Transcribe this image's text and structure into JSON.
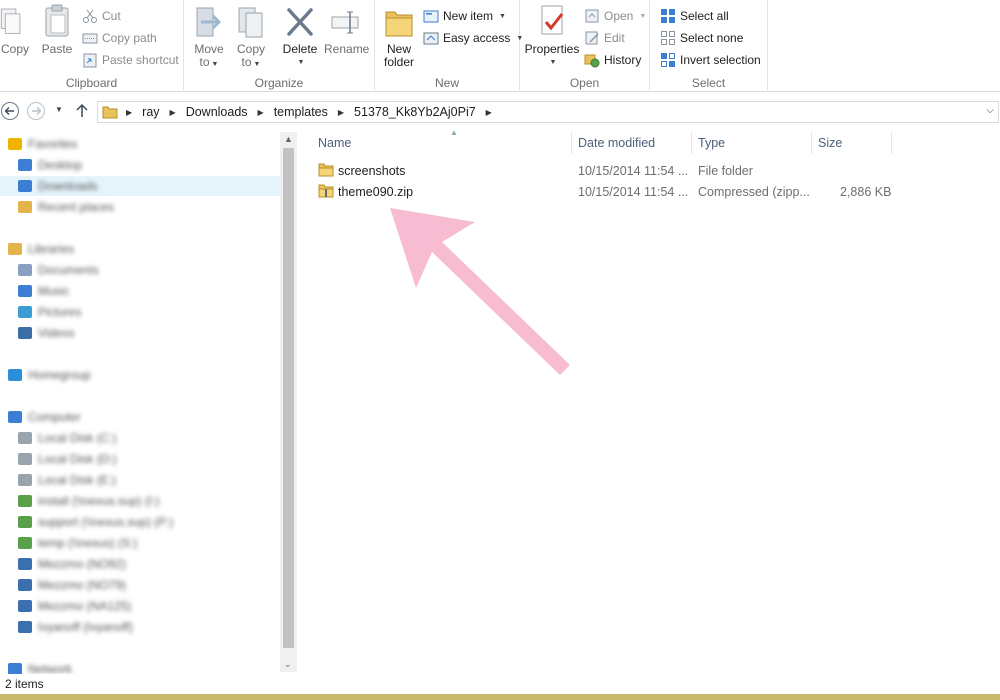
{
  "ribbon": {
    "clipboard": {
      "label": "Clipboard",
      "copy": "Copy",
      "paste": "Paste",
      "cut": "Cut",
      "copy_path": "Copy path",
      "paste_shortcut": "Paste shortcut"
    },
    "organize": {
      "label": "Organize",
      "move_to": "Move",
      "move_to_2": "to",
      "copy_to": "Copy",
      "copy_to_2": "to",
      "delete": "Delete",
      "rename": "Rename"
    },
    "new": {
      "label": "New",
      "new_folder": "New",
      "new_folder_2": "folder",
      "new_item": "New item",
      "easy_access": "Easy access"
    },
    "open": {
      "label": "Open",
      "properties": "Properties",
      "open": "Open",
      "edit": "Edit",
      "history": "History"
    },
    "select": {
      "label": "Select",
      "select_all": "Select all",
      "select_none": "Select none",
      "invert_selection": "Invert selection"
    }
  },
  "address": {
    "crumbs": [
      "ray",
      "Downloads",
      "templates",
      "51378_Kk8Yb2Aj0Pi7"
    ]
  },
  "navpane": {
    "items": [
      {
        "label": "Favorites",
        "icon": "star-icon",
        "color": "#f0b400"
      },
      {
        "label": "Desktop",
        "icon": "desktop-icon",
        "color": "#3b7ed3"
      },
      {
        "label": "Downloads",
        "icon": "downloads-icon",
        "color": "#3b7ed3"
      },
      {
        "label": "Recent places",
        "icon": "recent-places-icon",
        "color": "#e3b44a"
      },
      {
        "label": "Libraries",
        "icon": "libraries-icon",
        "color": "#e3b44a"
      },
      {
        "label": "Documents",
        "icon": "documents-icon",
        "color": "#8aa0c0"
      },
      {
        "label": "Music",
        "icon": "music-icon",
        "color": "#3b7ed3"
      },
      {
        "label": "Pictures",
        "icon": "pictures-icon",
        "color": "#3b9ed3"
      },
      {
        "label": "Videos",
        "icon": "videos-icon",
        "color": "#3a6ea5"
      },
      {
        "label": "Homegroup",
        "icon": "homegroup-icon",
        "color": "#2a8fd8"
      },
      {
        "label": "Computer",
        "icon": "computer-icon",
        "color": "#3b7ed3"
      },
      {
        "label": "Local Disk (C:)",
        "icon": "disk-icon",
        "color": "#9aa4ae"
      },
      {
        "label": "Local Disk (D:)",
        "icon": "disk-icon",
        "color": "#9aa4ae"
      },
      {
        "label": "Local Disk (E:)",
        "icon": "disk-icon",
        "color": "#9aa4ae"
      },
      {
        "label": "install (\\\\nexus.sup) (I:)",
        "icon": "network-drive-icon",
        "color": "#5aa04a"
      },
      {
        "label": "support (\\\\nexus.sup) (P:)",
        "icon": "network-drive-icon",
        "color": "#5aa04a"
      },
      {
        "label": "temp (\\\\nexus) (S:)",
        "icon": "network-drive-icon",
        "color": "#5aa04a"
      },
      {
        "label": "Mezzmo (NO92)",
        "icon": "media-icon",
        "color": "#3b6fb0"
      },
      {
        "label": "Mezzmo (NO79)",
        "icon": "media-icon",
        "color": "#3b6fb0"
      },
      {
        "label": "Mezzmo (NA125)",
        "icon": "media-icon",
        "color": "#3b6fb0"
      },
      {
        "label": "Ivyanoff (Ivyanoff)",
        "icon": "media-icon",
        "color": "#3b6fb0"
      },
      {
        "label": "Network",
        "icon": "network-icon",
        "color": "#3b7ed3"
      }
    ]
  },
  "filelist": {
    "columns": {
      "name": "Name",
      "date": "Date modified",
      "type": "Type",
      "size": "Size"
    },
    "rows": [
      {
        "name": "screenshots",
        "date": "10/15/2014 11:54 ...",
        "type": "File folder",
        "size": "",
        "icon": "folder-icon"
      },
      {
        "name": "theme090.zip",
        "date": "10/15/2014 11:54 ...",
        "type": "Compressed (zipp...",
        "size": "2,886 KB",
        "icon": "zip-folder-icon"
      }
    ]
  },
  "status": {
    "count": "2 items"
  },
  "colors": {
    "annotation_arrow": "#f7bcd2",
    "accent": "#3b7ed3",
    "folder": "#e8c25a"
  }
}
